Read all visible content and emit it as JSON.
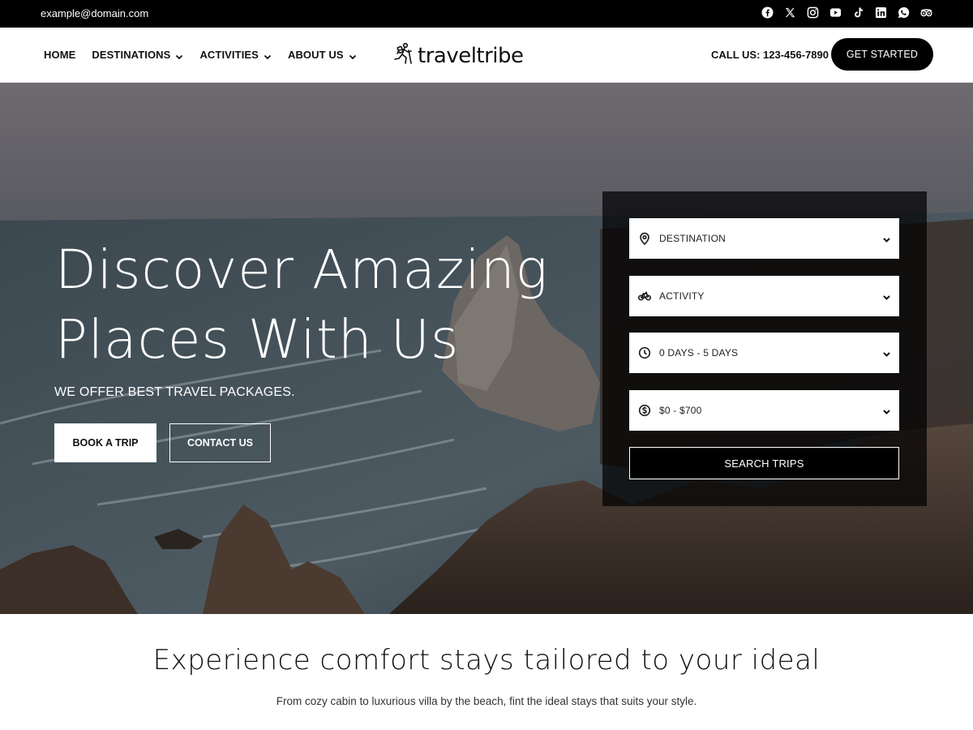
{
  "topbar": {
    "email": "example@domain.com",
    "socials": [
      "facebook-icon",
      "x-icon",
      "instagram-icon",
      "youtube-icon",
      "tiktok-icon",
      "linkedin-icon",
      "whatsapp-icon",
      "tripadvisor-icon"
    ]
  },
  "header": {
    "nav": [
      {
        "label": "HOME",
        "dropdown": false
      },
      {
        "label": "DESTINATIONS",
        "dropdown": true
      },
      {
        "label": "ACTIVITIES",
        "dropdown": true
      },
      {
        "label": "ABOUT US",
        "dropdown": true
      }
    ],
    "logo_text": "traveltribe",
    "call": "CALL US: 123-456-7890",
    "cta_label": "GET STARTED"
  },
  "hero": {
    "title_line1": "Discover Amazing",
    "title_line2": "Places With Us",
    "subtitle": "WE OFFER BEST TRAVEL PACKAGES.",
    "book_label": "BOOK A TRIP",
    "contact_label": "CONTACT US"
  },
  "search": {
    "fields": [
      {
        "icon": "location-pin-icon",
        "label": "DESTINATION"
      },
      {
        "icon": "bicycle-icon",
        "label": "ACTIVITY"
      },
      {
        "icon": "clock-icon",
        "label": "0 DAYS - 5 DAYS"
      },
      {
        "icon": "dollar-icon",
        "label": "$0 - $700"
      }
    ],
    "button_label": "SEARCH TRIPS"
  },
  "section": {
    "title": "Experience comfort stays tailored to your ideal",
    "subtitle": "From cozy cabin to luxurious villa by the beach, fint the ideal stays that suits your style."
  },
  "colors": {
    "topbar_bg": "#000000",
    "primary_button": "#000000",
    "text_dark": "#111111"
  }
}
